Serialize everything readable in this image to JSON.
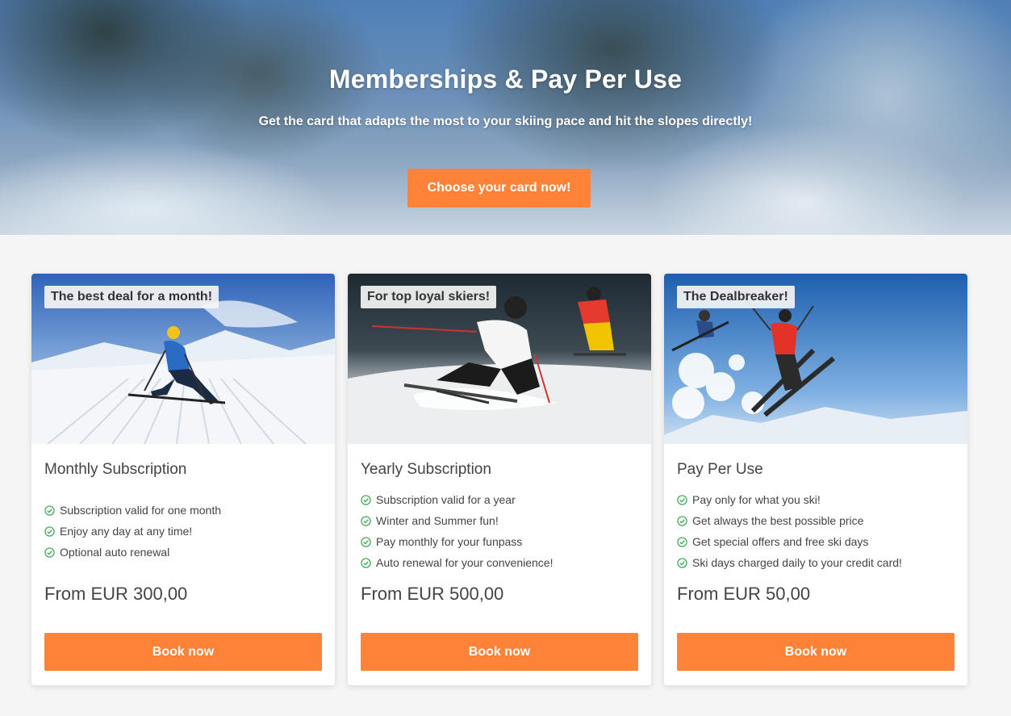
{
  "hero": {
    "title": "Memberships & Pay Per Use",
    "subtitle": "Get the card that adapts the most to your skiing pace and hit the slopes directly!",
    "cta_label": "Choose your card now!"
  },
  "colors": {
    "accent": "#fd8339",
    "check": "#3aa655"
  },
  "cards": [
    {
      "badge": "The best deal for a month!",
      "title": "Monthly Subscription",
      "features": [
        "Subscription valid for one month",
        "Enjoy any day at any time!",
        "Optional auto renewal"
      ],
      "price": "From EUR 300,00",
      "button_label": "Book now",
      "image": "skier-carving-on-groomed-slope"
    },
    {
      "badge": "For top loyal skiers!",
      "title": "Yearly Subscription",
      "features": [
        "Subscription valid for a year",
        "Winter and Summer fun!",
        "Pay monthly for your funpass",
        "Auto renewal for your convenience!"
      ],
      "price": "From EUR 500,00",
      "button_label": "Book now",
      "image": "two-skiers-racing"
    },
    {
      "badge": "The Dealbreaker!",
      "title": "Pay Per Use",
      "features": [
        "Pay only for what you ski!",
        "Get always the best possible price",
        "Get special offers and free ski days",
        "Ski days charged daily to your credit card!"
      ],
      "price": "From EUR 50,00",
      "button_label": "Book now",
      "image": "skiers-jumping-in-air"
    }
  ]
}
